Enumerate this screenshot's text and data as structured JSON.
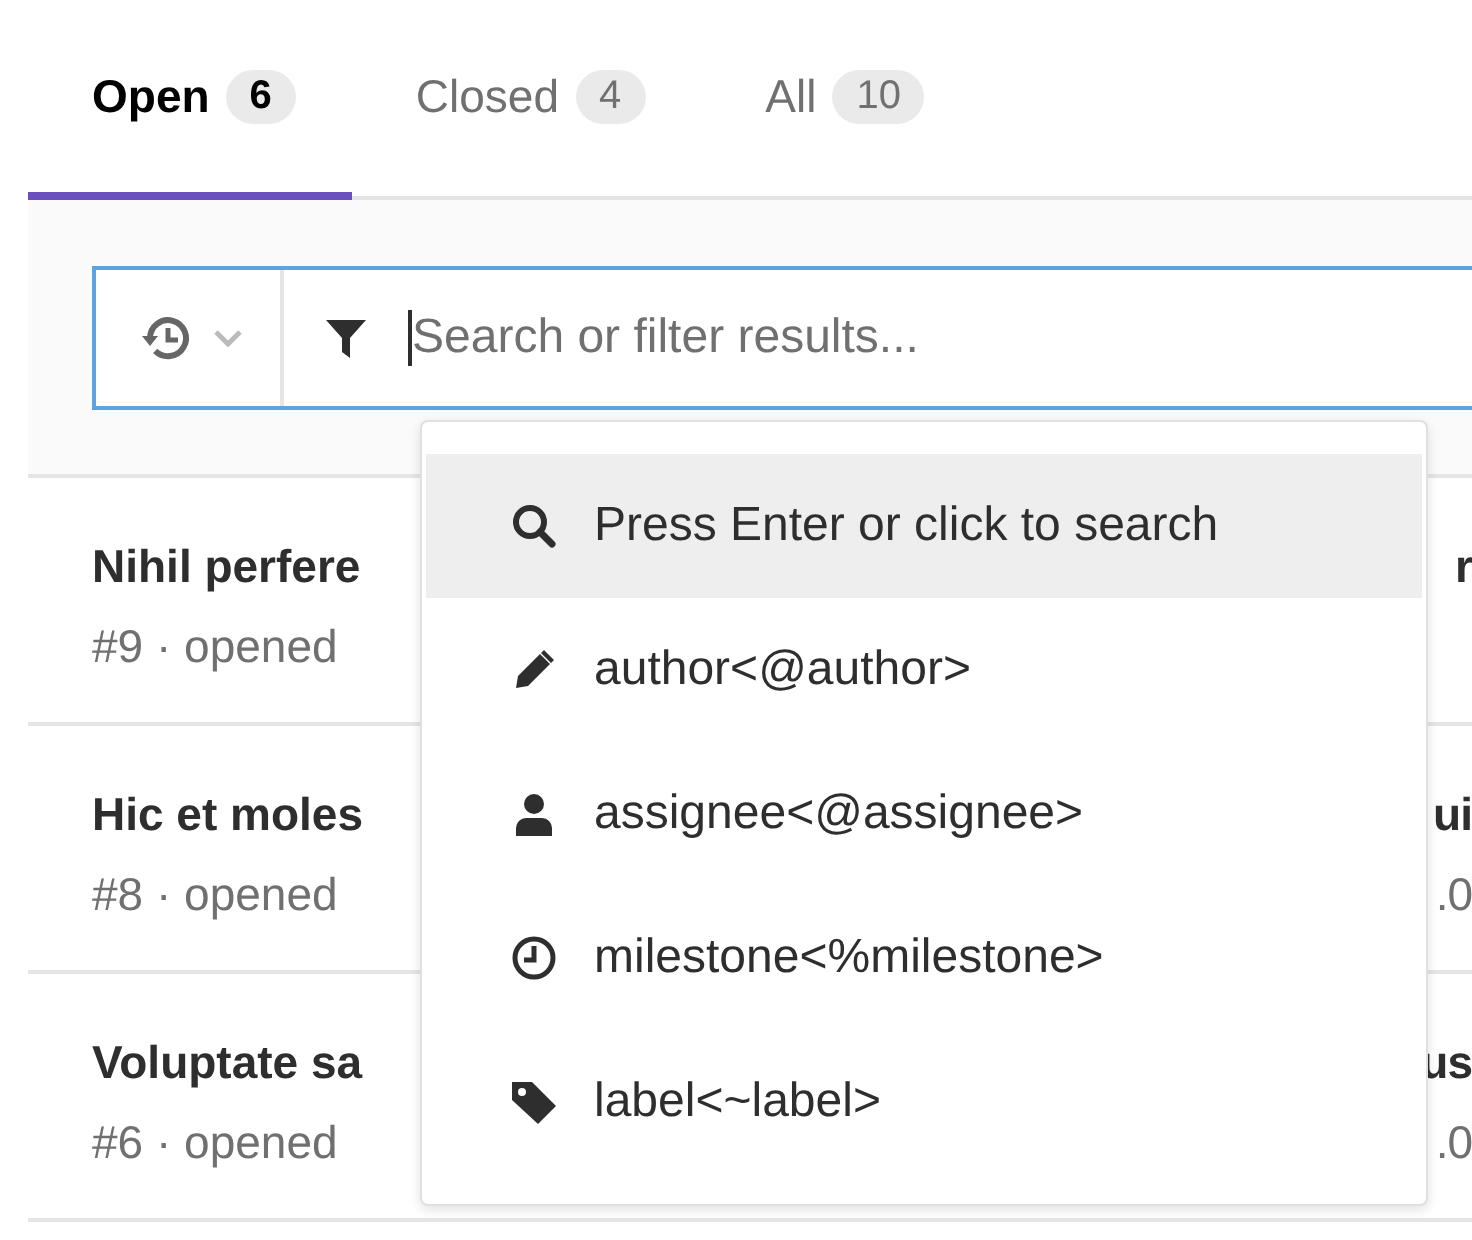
{
  "tabs": [
    {
      "label": "Open",
      "count": "6",
      "selected": true
    },
    {
      "label": "Closed",
      "count": "4",
      "selected": false
    },
    {
      "label": "All",
      "count": "10",
      "selected": false
    }
  ],
  "search": {
    "placeholder": "Search or filter results..."
  },
  "dropdown": {
    "items": [
      {
        "kind": "search",
        "label": "Press Enter or click to search",
        "selected": true
      },
      {
        "kind": "author",
        "label": "author<@author>",
        "selected": false
      },
      {
        "kind": "assignee",
        "label": "assignee<@assignee>",
        "selected": false
      },
      {
        "kind": "milestone",
        "label": "milestone<%milestone>",
        "selected": false
      },
      {
        "kind": "label",
        "label": "label<~label>",
        "selected": false
      }
    ]
  },
  "issues": [
    {
      "title": "Nihil perfere",
      "title_tail": "r",
      "meta": "#9 · opened"
    },
    {
      "title": "Hic et moles",
      "title_tail": "ui",
      "meta": "#8 · opened",
      "meta_tail": ".0"
    },
    {
      "title": "Voluptate sa",
      "title_tail": "us",
      "meta": "#6 · opened",
      "meta_tail": ".0"
    }
  ]
}
